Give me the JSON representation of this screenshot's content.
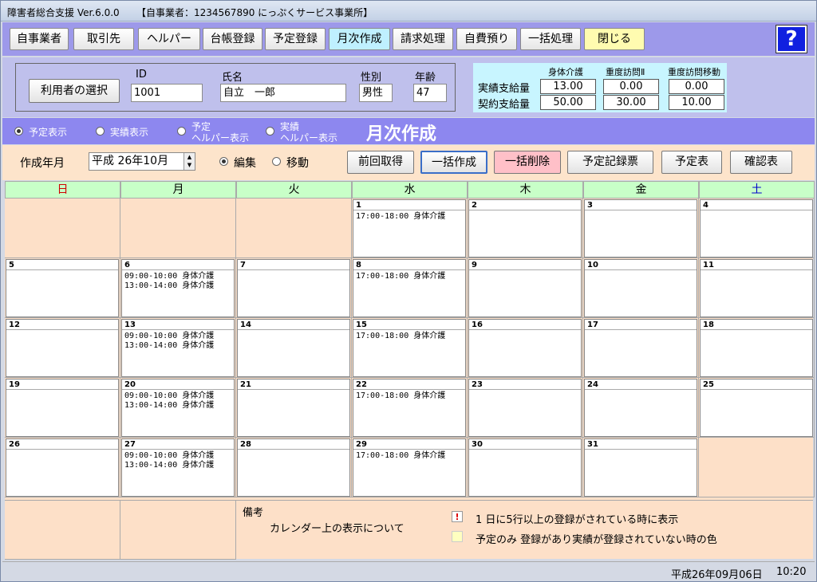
{
  "window": {
    "app_title": "障害者総合支援 Ver.6.0.0",
    "office": "【自事業者：1234567890 にっぷくサービス事業所】"
  },
  "toolbar": {
    "buttons": [
      "自事業者",
      "取引先",
      "ヘルパー",
      "台帳登録",
      "予定登録",
      "月次作成",
      "請求処理",
      "自費預り",
      "一括処理",
      "閉じる"
    ],
    "help": "?"
  },
  "user": {
    "select_label": "利用者の選択",
    "id_label": "ID",
    "id": "1001",
    "name_label": "氏名",
    "name": "自立　一郎",
    "sex_label": "性別",
    "sex": "男性",
    "age_label": "年齢",
    "age": "47"
  },
  "pay": {
    "headers": [
      "身体介護",
      "重度訪問Ⅱ",
      "重度訪問移動"
    ],
    "actual_label": "実績支給量",
    "contract_label": "契約支給量",
    "actual": [
      "13.00",
      "0.00",
      "0.00"
    ],
    "contract": [
      "50.00",
      "30.00",
      "10.00"
    ]
  },
  "modes": {
    "plan": "予定表示",
    "actual": "実績表示",
    "plan_helper_1": "予定",
    "plan_helper_2": "ヘルパー表示",
    "actual_helper_1": "実績",
    "actual_helper_2": "ヘルパー表示",
    "title": "月次作成"
  },
  "controls": {
    "ym_label": "作成年月",
    "ym": "平成 26年10月",
    "edit": "編集",
    "move": "移動",
    "buttons": [
      "前回取得",
      "一括作成",
      "一括削除",
      "予定記録票",
      "予定表",
      "確認表"
    ]
  },
  "calendar": {
    "weekdays": [
      "日",
      "月",
      "火",
      "水",
      "木",
      "金",
      "土"
    ],
    "days": [
      {
        "n": "1",
        "t": "17:00-18:00 身体介護"
      },
      {
        "n": "2",
        "t": ""
      },
      {
        "n": "3",
        "t": ""
      },
      {
        "n": "4",
        "t": ""
      },
      {
        "n": "5",
        "t": ""
      },
      {
        "n": "6",
        "t": "09:00-10:00 身体介護\n13:00-14:00 身体介護"
      },
      {
        "n": "7",
        "t": ""
      },
      {
        "n": "8",
        "t": "17:00-18:00 身体介護"
      },
      {
        "n": "9",
        "t": ""
      },
      {
        "n": "10",
        "t": ""
      },
      {
        "n": "11",
        "t": ""
      },
      {
        "n": "12",
        "t": ""
      },
      {
        "n": "13",
        "t": "09:00-10:00 身体介護\n13:00-14:00 身体介護"
      },
      {
        "n": "14",
        "t": ""
      },
      {
        "n": "15",
        "t": "17:00-18:00 身体介護"
      },
      {
        "n": "16",
        "t": ""
      },
      {
        "n": "17",
        "t": ""
      },
      {
        "n": "18",
        "t": ""
      },
      {
        "n": "19",
        "t": ""
      },
      {
        "n": "20",
        "t": "09:00-10:00 身体介護\n13:00-14:00 身体介護"
      },
      {
        "n": "21",
        "t": ""
      },
      {
        "n": "22",
        "t": "17:00-18:00 身体介護"
      },
      {
        "n": "23",
        "t": ""
      },
      {
        "n": "24",
        "t": ""
      },
      {
        "n": "25",
        "t": ""
      },
      {
        "n": "26",
        "t": ""
      },
      {
        "n": "27",
        "t": "09:00-10:00 身体介護\n13:00-14:00 身体介護"
      },
      {
        "n": "28",
        "t": ""
      },
      {
        "n": "29",
        "t": "17:00-18:00 身体介護"
      },
      {
        "n": "30",
        "t": ""
      },
      {
        "n": "31",
        "t": ""
      }
    ]
  },
  "notes": {
    "label": "備考",
    "sub": "カレンダー上の表示について",
    "mark": "!",
    "legend1": "1 日に5行以上の登録がされている時に表示",
    "legend2": "予定のみ 登録があり実績が登録されていない時の色"
  },
  "status": {
    "date": "平成26年09月06日",
    "time": "10:20"
  },
  "colors": {
    "toolbar_bg": "#9d99ea",
    "mode_bg": "#8d87ef",
    "calendar_bg": "#fde0c8",
    "header_bg": "#c8ffc8",
    "sunday": "#d00000",
    "saturday": "#0000cc"
  }
}
